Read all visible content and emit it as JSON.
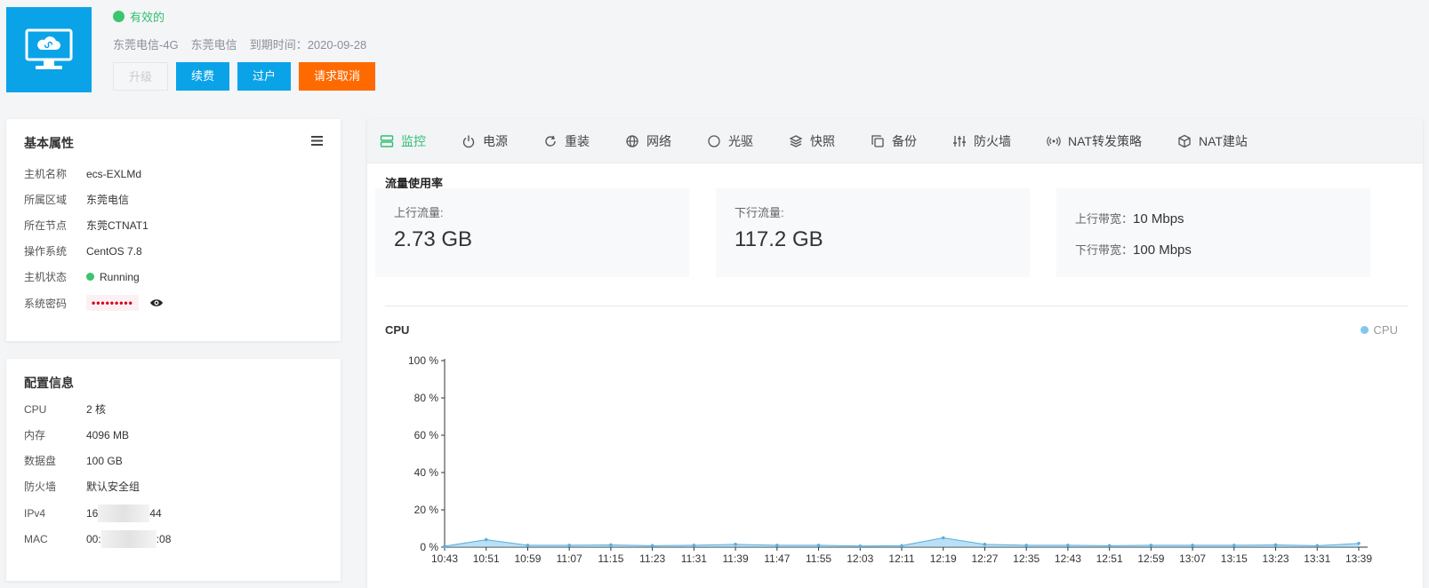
{
  "header": {
    "status": "有效的",
    "carrier": "东莞电信-4G",
    "region": "东莞电信",
    "expiry_label": "到期时间：",
    "expiry_date": "2020-09-28",
    "buttons": {
      "upgrade": "升级",
      "renew": "续费",
      "transfer": "过户",
      "cancel": "请求取消"
    }
  },
  "basic": {
    "title": "基本属性",
    "rows": [
      {
        "key": "主机名称",
        "value": "ecs-EXLMd"
      },
      {
        "key": "所属区域",
        "value": "东莞电信"
      },
      {
        "key": "所在节点",
        "value": "东莞CTNAT1"
      },
      {
        "key": "操作系统",
        "value": "CentOS 7.8"
      },
      {
        "key": "主机状态",
        "value": "Running"
      },
      {
        "key": "系统密码",
        "value": "•••••••••"
      }
    ]
  },
  "config": {
    "title": "配置信息",
    "rows": [
      {
        "key": "CPU",
        "value": "2 核"
      },
      {
        "key": "内存",
        "value": "4096 MB"
      },
      {
        "key": "数据盘",
        "value": "100 GB"
      },
      {
        "key": "防火墙",
        "value": "默认安全组"
      },
      {
        "key": "IPv4",
        "prefix": "16",
        "suffix": "44"
      },
      {
        "key": "MAC",
        "prefix": "00:",
        "suffix": ":08"
      }
    ]
  },
  "tabs": [
    {
      "label": "监控",
      "icon": "monitor-icon"
    },
    {
      "label": "电源",
      "icon": "power-icon"
    },
    {
      "label": "重装",
      "icon": "refresh-icon"
    },
    {
      "label": "网络",
      "icon": "globe-icon"
    },
    {
      "label": "光驱",
      "icon": "disc-icon"
    },
    {
      "label": "快照",
      "icon": "layers-icon"
    },
    {
      "label": "备份",
      "icon": "copy-icon"
    },
    {
      "label": "防火墙",
      "icon": "sliders-icon"
    },
    {
      "label": "NAT转发策略",
      "icon": "broadcast-icon"
    },
    {
      "label": "NAT建站",
      "icon": "cube-icon"
    }
  ],
  "traffic": {
    "title": "流量使用率",
    "upload_label": "上行流量:",
    "upload_value": "2.73 GB",
    "download_label": "下行流量:",
    "download_value": "117.2 GB",
    "up_bw_label": "上行带宽：",
    "up_bw_value": "10 Mbps",
    "down_bw_label": "下行带宽：",
    "down_bw_value": "100 Mbps"
  },
  "colors": {
    "accent": "#0aa3e8",
    "danger": "#ff6a00",
    "success": "#2fbf71",
    "series": "#82c7ef"
  },
  "chart_data": {
    "type": "area",
    "title": "CPU",
    "xlabel": "",
    "ylabel": "",
    "ylim": [
      0,
      100
    ],
    "y_ticks": [
      "0 %",
      "20 %",
      "40 %",
      "60 %",
      "80 %",
      "100 %"
    ],
    "legend": "top-right",
    "grid": false,
    "categories": [
      "10:43",
      "10:51",
      "10:59",
      "11:07",
      "11:15",
      "11:23",
      "11:31",
      "11:39",
      "11:47",
      "11:55",
      "12:03",
      "12:11",
      "12:19",
      "12:27",
      "12:35",
      "12:43",
      "12:51",
      "12:59",
      "13:07",
      "13:15",
      "13:23",
      "13:31",
      "13:39"
    ],
    "series": [
      {
        "name": "CPU",
        "values": [
          0.5,
          4,
          1,
          1,
          1.2,
          0.8,
          1,
          1.5,
          1,
          1,
          0.6,
          0.8,
          5,
          1.5,
          1,
          1,
          0.8,
          1,
          1,
          1,
          1.2,
          0.8,
          2
        ]
      }
    ]
  }
}
